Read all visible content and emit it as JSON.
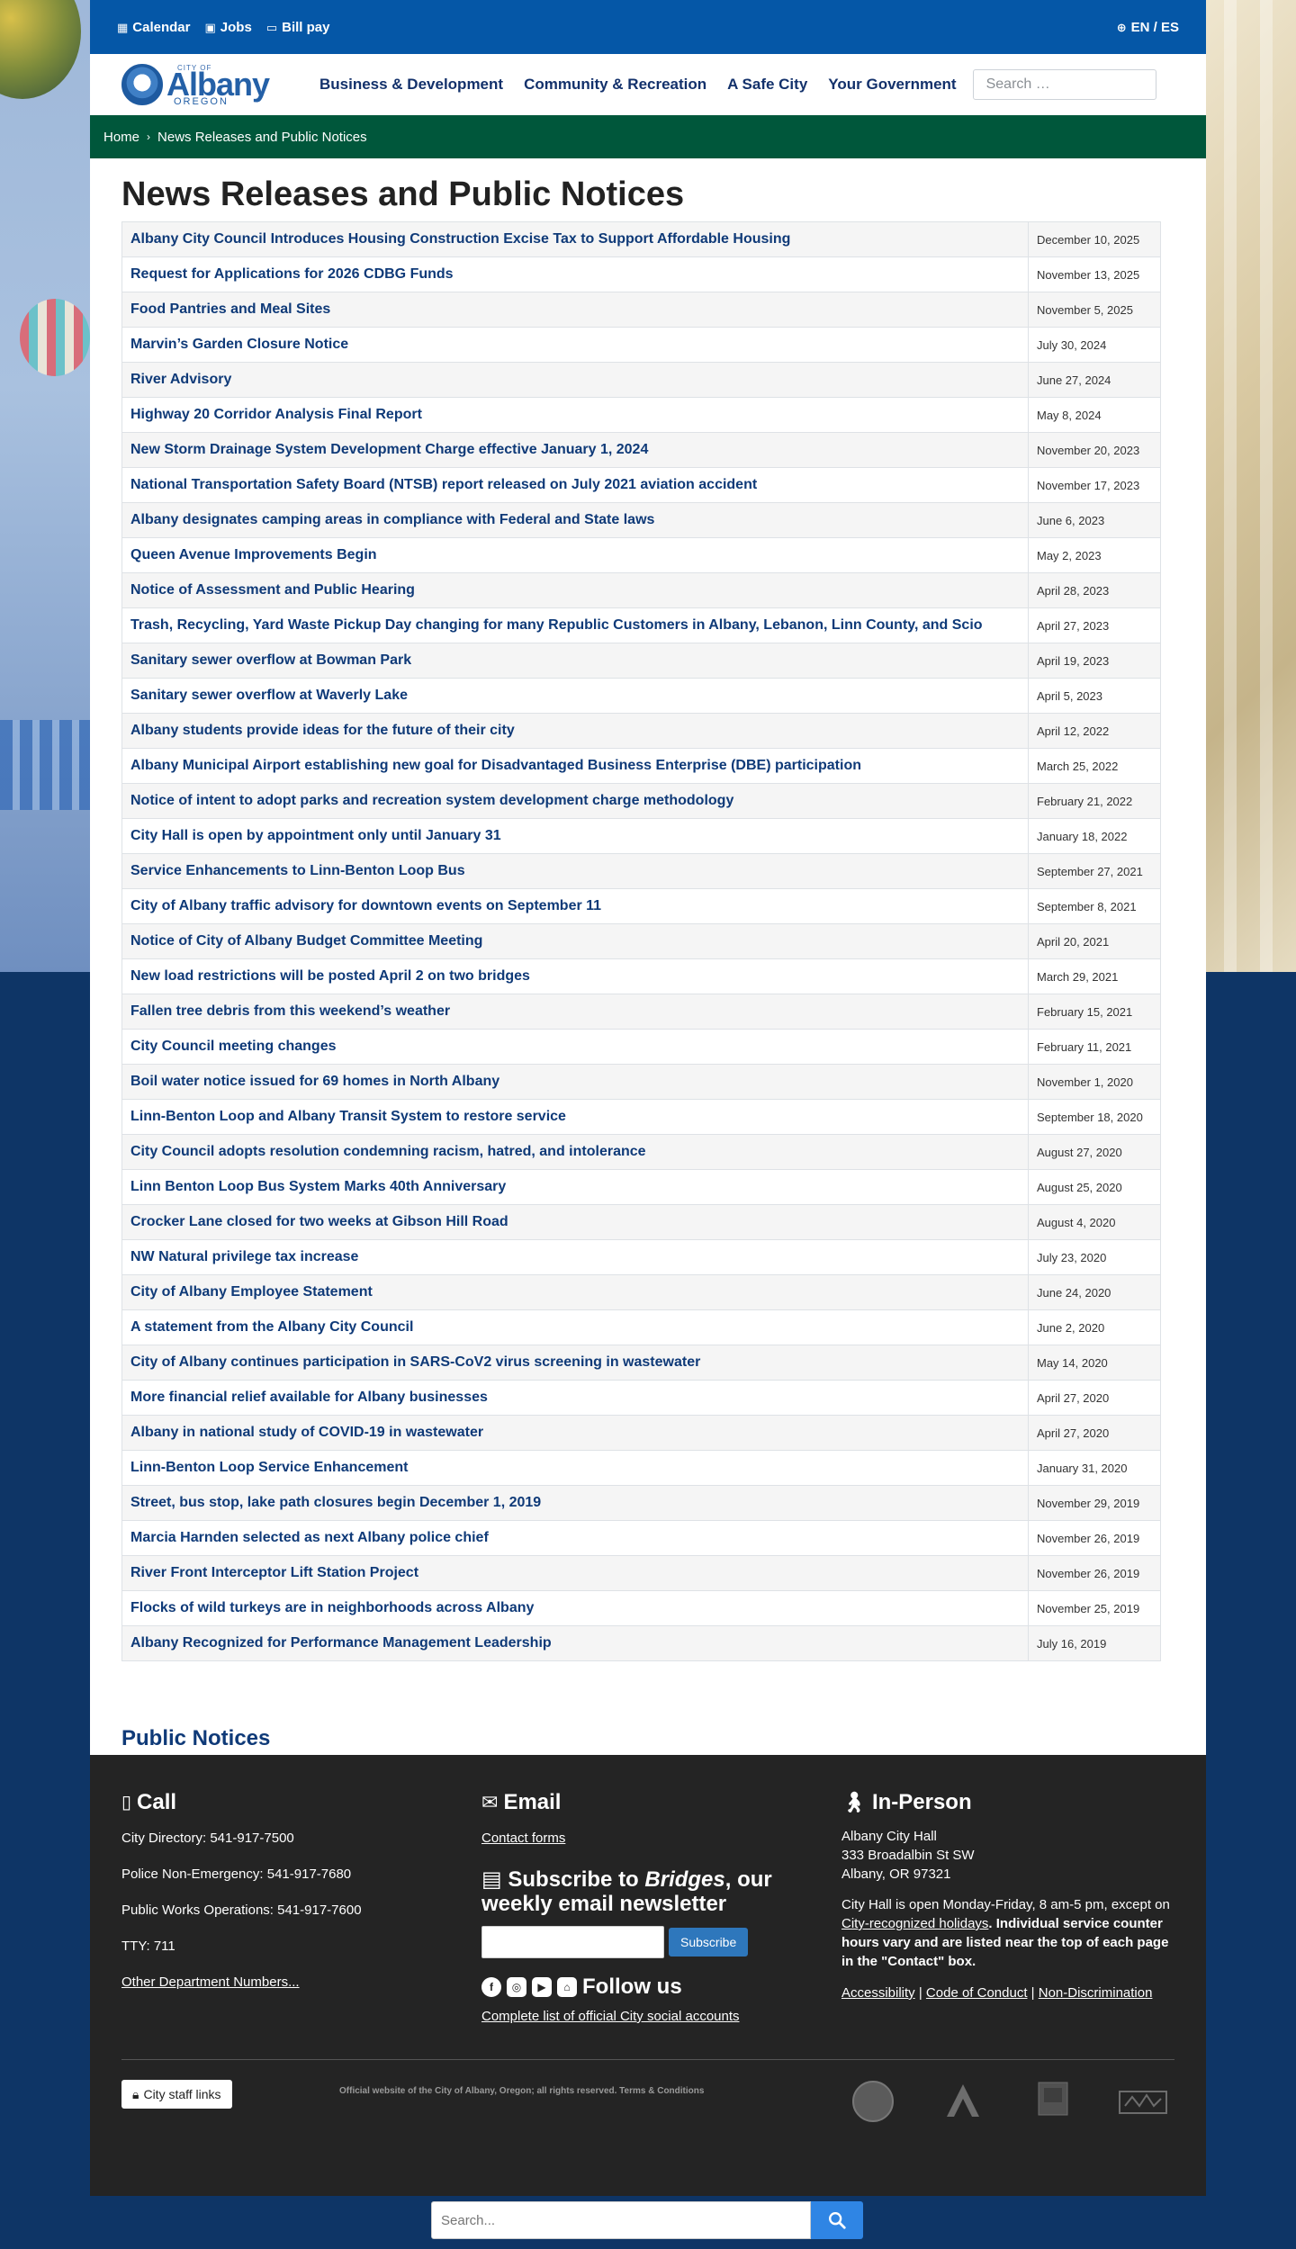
{
  "topbar": {
    "links": [
      {
        "label": "Calendar",
        "icon": "calendar-icon"
      },
      {
        "label": "Jobs",
        "icon": "briefcase-icon"
      },
      {
        "label": "Bill pay",
        "icon": "card-icon"
      }
    ],
    "language": "EN / ES"
  },
  "logo": {
    "city_of": "CITY OF",
    "name": "Albany",
    "state": "OREGON"
  },
  "nav": {
    "items": [
      "Business & Development",
      "Community & Recreation",
      "A Safe City",
      "Your Government"
    ],
    "search_placeholder": "Search …"
  },
  "breadcrumb": {
    "home": "Home",
    "current": "News Releases and Public Notices"
  },
  "page_title": "News Releases and Public Notices",
  "news": [
    {
      "title": "Albany City Council Introduces Housing Construction Excise Tax to Support Affordable Housing",
      "date": "December 10, 2025"
    },
    {
      "title": "Request for Applications for 2026 CDBG Funds",
      "date": "November 13, 2025"
    },
    {
      "title": "Food Pantries and Meal Sites",
      "date": "November 5, 2025"
    },
    {
      "title": "Marvin’s Garden Closure Notice",
      "date": "July 30, 2024"
    },
    {
      "title": "River Advisory",
      "date": "June 27, 2024"
    },
    {
      "title": "Highway 20 Corridor Analysis Final Report",
      "date": "May 8, 2024"
    },
    {
      "title": "New Storm Drainage System Development Charge effective January 1, 2024",
      "date": "November 20, 2023"
    },
    {
      "title": "National Transportation Safety Board (NTSB) report released on July 2021 aviation accident",
      "date": "November 17, 2023"
    },
    {
      "title": "Albany designates camping areas in compliance with Federal and State laws",
      "date": "June 6, 2023"
    },
    {
      "title": "Queen Avenue Improvements Begin",
      "date": "May 2, 2023"
    },
    {
      "title": "Notice of Assessment and Public Hearing",
      "date": "April 28, 2023"
    },
    {
      "title": "Trash, Recycling, Yard Waste Pickup Day changing for many Republic Customers in Albany, Lebanon, Linn County, and Scio",
      "date": "April 27, 2023"
    },
    {
      "title": "Sanitary sewer overflow at Bowman Park",
      "date": "April 19, 2023"
    },
    {
      "title": "Sanitary sewer overflow at Waverly Lake",
      "date": "April 5, 2023"
    },
    {
      "title": "Albany students provide ideas for the future of their city",
      "date": "April 12, 2022"
    },
    {
      "title": "Albany Municipal Airport establishing new goal for Disadvantaged Business Enterprise (DBE) participation",
      "date": "March 25, 2022"
    },
    {
      "title": "Notice of intent to adopt parks and recreation system development charge methodology",
      "date": "February 21, 2022"
    },
    {
      "title": "City Hall is open by appointment only until January 31",
      "date": "January 18, 2022"
    },
    {
      "title": "Service Enhancements to Linn-Benton Loop Bus",
      "date": "September 27, 2021"
    },
    {
      "title": "City of Albany traffic advisory for downtown events on September 11",
      "date": "September 8, 2021"
    },
    {
      "title": "Notice of City of Albany Budget Committee Meeting",
      "date": "April 20, 2021"
    },
    {
      "title": "New load restrictions will be posted April 2 on two bridges",
      "date": "March 29, 2021"
    },
    {
      "title": "Fallen tree debris from this weekend’s weather",
      "date": "February 15, 2021"
    },
    {
      "title": "City Council meeting changes",
      "date": "February 11, 2021"
    },
    {
      "title": "Boil water notice issued for 69 homes in North Albany",
      "date": "November 1, 2020"
    },
    {
      "title": "Linn-Benton Loop and Albany Transit System to restore service",
      "date": "September 18, 2020"
    },
    {
      "title": "City Council adopts resolution condemning racism, hatred, and intolerance",
      "date": "August 27, 2020"
    },
    {
      "title": "Linn Benton Loop Bus System Marks 40th Anniversary",
      "date": "August 25, 2020"
    },
    {
      "title": "Crocker Lane closed for two weeks at Gibson Hill Road",
      "date": "August 4, 2020"
    },
    {
      "title": "NW Natural privilege tax increase",
      "date": "July 23, 2020"
    },
    {
      "title": "City of Albany Employee Statement",
      "date": "June 24, 2020"
    },
    {
      "title": "A statement from the Albany City Council",
      "date": "June 2, 2020"
    },
    {
      "title": "City of Albany continues participation in SARS-CoV2 virus screening in wastewater",
      "date": "May 14, 2020"
    },
    {
      "title": "More financial relief available for Albany businesses",
      "date": "April 27, 2020"
    },
    {
      "title": "Albany in national study of COVID-19 in wastewater",
      "date": "April 27, 2020"
    },
    {
      "title": "Linn-Benton Loop Service Enhancement",
      "date": "January 31, 2020"
    },
    {
      "title": "Street, bus stop, lake path closures begin December 1, 2019",
      "date": "November 29, 2019"
    },
    {
      "title": "Marcia Harnden selected as next Albany police chief",
      "date": "November 26, 2019"
    },
    {
      "title": "River Front Interceptor Lift Station Project",
      "date": "November 26, 2019"
    },
    {
      "title": "Flocks of wild turkeys are in neighborhoods across Albany",
      "date": "November 25, 2019"
    },
    {
      "title": "Albany Recognized for Performance Management Leadership",
      "date": "July 16, 2019"
    }
  ],
  "public_notices_heading": "Public Notices",
  "footer": {
    "call": {
      "heading": "Call",
      "lines": [
        "City Directory: 541-917-7500",
        "Police Non-Emergency: 541-917-7680",
        "Public Works Operations: 541-917-7600",
        "TTY: 711"
      ],
      "other_link": "Other Department Numbers..."
    },
    "email": {
      "heading": "Email",
      "contact_link": "Contact forms",
      "subscribe_prefix": "Subscribe to ",
      "subscribe_name": "Bridges",
      "subscribe_suffix": ", our weekly email newsletter",
      "subscribe_button": "Subscribe",
      "follow_heading": "Follow us",
      "social_link": "Complete list of official City social accounts"
    },
    "inperson": {
      "heading": "In-Person",
      "address": [
        "Albany City Hall",
        "333 Broadalbin St SW",
        "Albany, OR 97321"
      ],
      "hours_prefix": "City Hall is open Monday-Friday, 8 am-5 pm, except on ",
      "hours_link": "City-recognized holidays",
      "hours_bold": ". Individual service counter hours vary and are listed near the top of each page in the \"Contact\" box.",
      "legal_links": [
        "Accessibility",
        "Code of Conduct",
        "Non-Discrimination"
      ]
    },
    "staff_button": "City staff links",
    "copyright": "Official website of the City of Albany, Oregon; all rights reserved. Terms & Conditions"
  },
  "bottom_search": {
    "placeholder": "Search..."
  },
  "colors": {
    "topbar": "#0557a7",
    "breadcrumb": "#00573b",
    "link": "#0f3a78",
    "footer": "#242424",
    "search_button": "#2f85e4"
  }
}
